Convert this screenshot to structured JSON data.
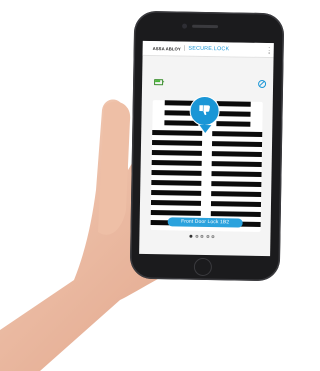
{
  "app": {
    "brand_primary": "ASSA ABLOY",
    "brand_separator": "|",
    "brand_product": "SECURE.LOCK",
    "accent_color": "#1a96d6"
  },
  "status": {
    "battery_icon": "battery-icon",
    "connection_icon": "no-connection-icon"
  },
  "lock": {
    "pin_icon": "thumb-down-icon",
    "button_label": "Front Door Lock 1B2",
    "pager_count": 5,
    "pager_active_index": 0
  }
}
